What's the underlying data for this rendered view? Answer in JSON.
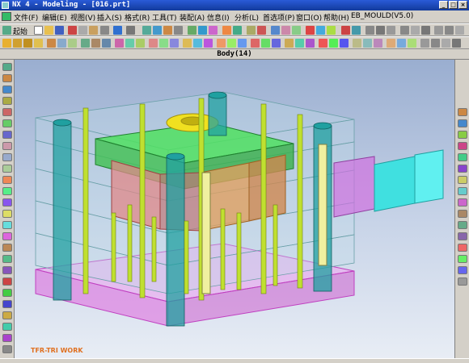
{
  "window": {
    "title": "NX 4 - Modeling - [016.prt]"
  },
  "menu": {
    "items": [
      {
        "label": "文件(F)"
      },
      {
        "label": "编辑(E)"
      },
      {
        "label": "视图(V)"
      },
      {
        "label": "插入(S)"
      },
      {
        "label": "格式(R)"
      },
      {
        "label": "工具(T)"
      },
      {
        "label": "装配(A)"
      },
      {
        "label": "信息(I)"
      },
      {
        "label": "分析(L)"
      },
      {
        "label": "首选项(P)"
      },
      {
        "label": "窗口(O)"
      },
      {
        "label": "帮助(H)"
      },
      {
        "label": "EB_MOULD(V5.0)"
      }
    ]
  },
  "toolbar": {
    "start_label": "起始"
  },
  "view": {
    "header": "Body(14)"
  },
  "watermark": "TFR-TRI WORK"
}
